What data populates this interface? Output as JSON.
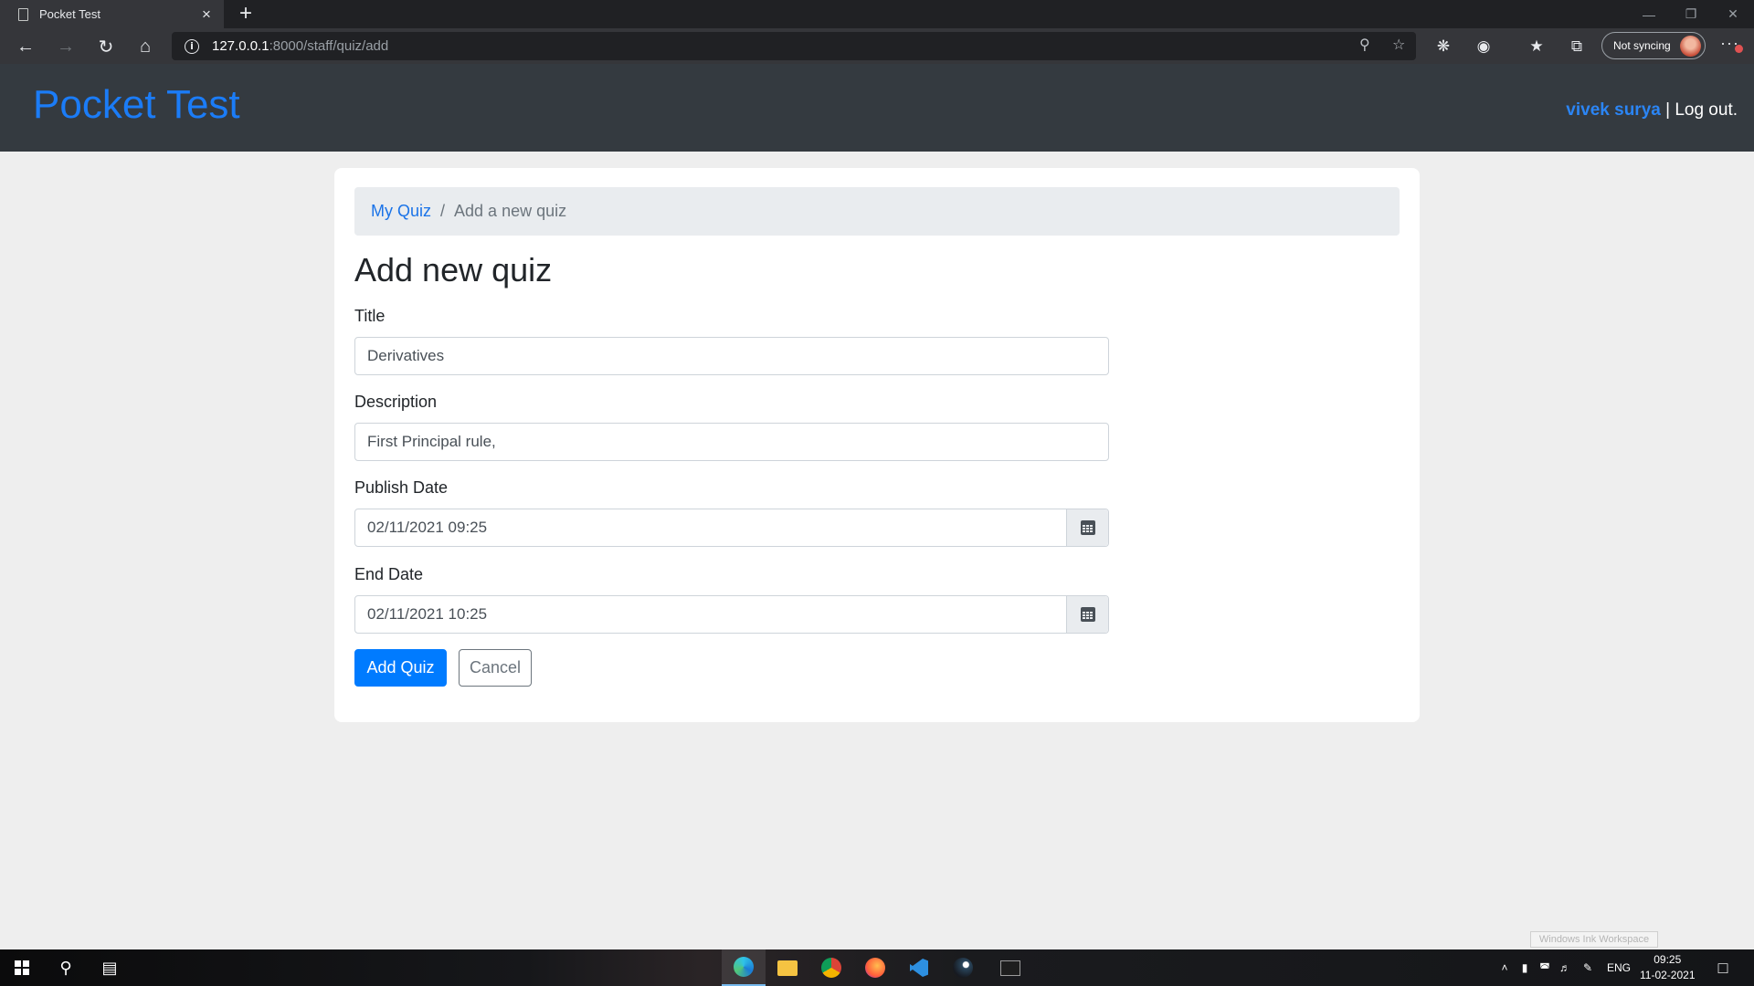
{
  "browser": {
    "tab_title": "Pocket Test",
    "tab_close": "×",
    "new_tab": "+",
    "url_host": "127.0.0.1",
    "url_path": ":8000/staff/quiz/add",
    "sync_label": "Not syncing",
    "more": "···"
  },
  "app": {
    "brand": "Pocket Test",
    "username": "vivek surya",
    "separator": " | ",
    "logout": "Log out."
  },
  "breadcrumb": {
    "parent": "My Quiz",
    "separator": "/",
    "current": "Add a new quiz"
  },
  "form": {
    "heading": "Add new quiz",
    "title_label": "Title",
    "title_value": "Derivatives",
    "description_label": "Description",
    "description_value": "First Principal rule,",
    "publish_label": "Publish Date",
    "publish_value": "02/11/2021 09:25",
    "end_label": "End Date",
    "end_value": "02/11/2021 10:25",
    "submit": "Add Quiz",
    "cancel": "Cancel"
  },
  "os": {
    "ink_workspace": "Windows Ink Workspace",
    "lang": "ENG",
    "time": "09:25",
    "date": "11-02-2021"
  },
  "colors": {
    "navbar": "#343a40",
    "brand": "#1b7cf7",
    "primary": "#007bff"
  }
}
